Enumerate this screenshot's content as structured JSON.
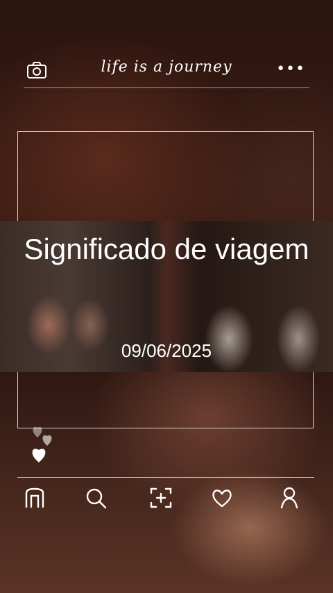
{
  "header": {
    "title": "life is a journey"
  },
  "post": {
    "title": "Significado de viagem",
    "date": "09/06/2025"
  },
  "icons": {
    "camera": "camera-icon",
    "more": "more-dots-icon",
    "home": "home-icon",
    "search": "search-icon",
    "add": "add-frame-icon",
    "like": "heart-icon",
    "profile": "profile-icon"
  }
}
